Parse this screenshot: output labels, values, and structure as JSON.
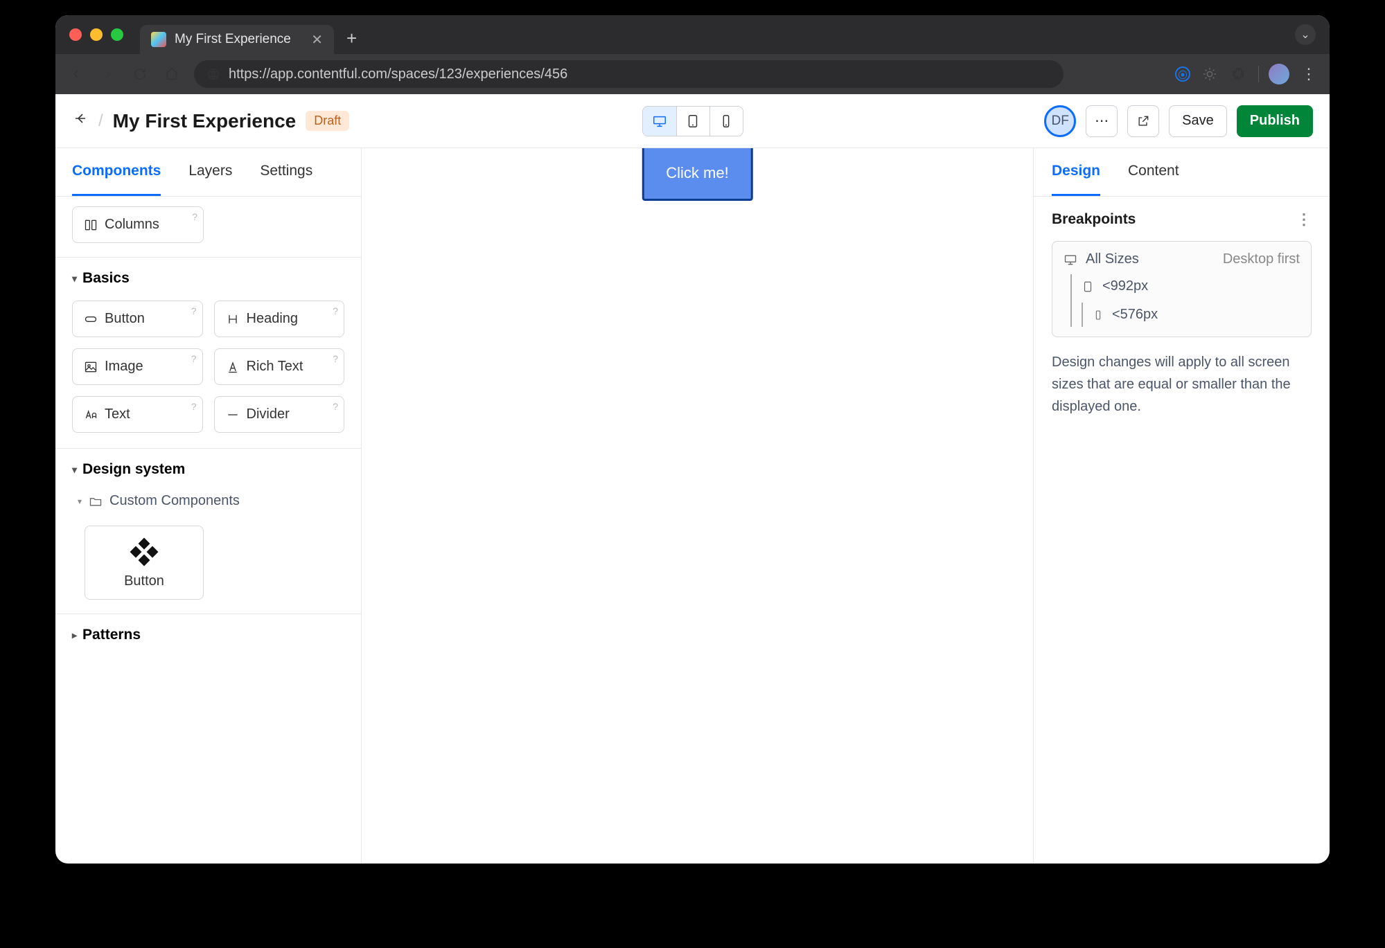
{
  "browser": {
    "tab_title": "My First Experience",
    "url": "https://app.contentful.com/spaces/123/experiences/456"
  },
  "header": {
    "title": "My First Experience",
    "status_badge": "Draft",
    "user_initials": "DF",
    "save_label": "Save",
    "publish_label": "Publish"
  },
  "left_panel": {
    "tabs": {
      "components": "Components",
      "layers": "Layers",
      "settings": "Settings"
    },
    "columns_label": "Columns",
    "basics": {
      "title": "Basics",
      "items": {
        "button": "Button",
        "heading": "Heading",
        "image": "Image",
        "rich_text": "Rich Text",
        "text": "Text",
        "divider": "Divider"
      }
    },
    "design_system": {
      "title": "Design system",
      "custom_folder": "Custom Components",
      "button_label": "Button"
    },
    "patterns": {
      "title": "Patterns"
    }
  },
  "canvas": {
    "button_text": "Click me!"
  },
  "right_panel": {
    "tabs": {
      "design": "Design",
      "content": "Content"
    },
    "breakpoints_title": "Breakpoints",
    "bp_all_sizes": "All Sizes",
    "bp_strategy": "Desktop first",
    "bp_992": "<992px",
    "bp_576": "<576px",
    "note": "Design changes will apply to all screen sizes that are equal or smaller than the displayed one."
  }
}
